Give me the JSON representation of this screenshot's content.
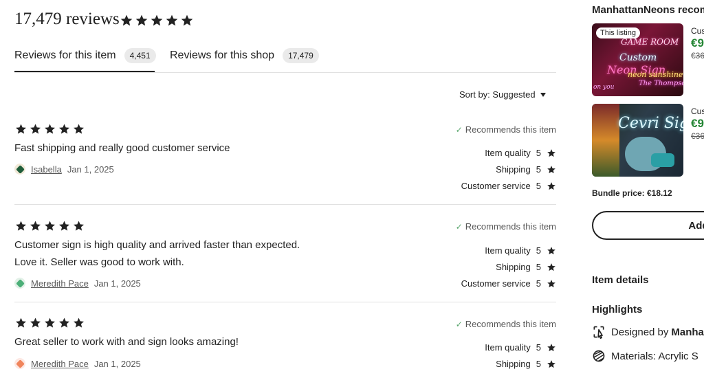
{
  "header": {
    "title": "17,479 reviews",
    "rating_stars": 5
  },
  "tabs": [
    {
      "label": "Reviews for this item",
      "count": "4,451",
      "active": true
    },
    {
      "label": "Reviews for this shop",
      "count": "17,479",
      "active": false
    }
  ],
  "sort": {
    "label": "Sort by: Suggested"
  },
  "reviews": [
    {
      "stars": 5,
      "text": "Fast shipping and really good customer service",
      "text2": "",
      "reviewer": "Isabella",
      "date": "Jan 1, 2025",
      "recommends": "Recommends this item",
      "ratings": [
        {
          "label": "Item quality",
          "value": "5"
        },
        {
          "label": "Shipping",
          "value": "5"
        },
        {
          "label": "Customer service",
          "value": "5"
        }
      ]
    },
    {
      "stars": 5,
      "text": "Customer sign is high quality and arrived faster than expected.",
      "text2": "Love it. Seller was good to work with.",
      "reviewer": "Meredith Pace",
      "date": "Jan 1, 2025",
      "recommends": "Recommends this item",
      "ratings": [
        {
          "label": "Item quality",
          "value": "5"
        },
        {
          "label": "Shipping",
          "value": "5"
        },
        {
          "label": "Customer service",
          "value": "5"
        }
      ]
    },
    {
      "stars": 5,
      "text": "Great seller to work with and sign looks amazing!",
      "text2": "",
      "reviewer": "Meredith Pace",
      "date": "Jan 1, 2025",
      "recommends": "Recommends this item",
      "ratings": [
        {
          "label": "Item quality",
          "value": "5"
        },
        {
          "label": "Shipping",
          "value": "5"
        }
      ]
    }
  ],
  "sidebar": {
    "shop_recommends": "ManhattanNeons recom",
    "listings": [
      {
        "badge": "This listing",
        "title": "Cus",
        "price": "€9",
        "original": "€36"
      },
      {
        "badge": "",
        "title": "Cus",
        "price": "€9",
        "original": "€36"
      }
    ],
    "bundle_price": "Bundle price: €18.12",
    "bundle_button": "Add",
    "item_details": "Item details",
    "highlights": "Highlights",
    "highlight_items": [
      {
        "icon": "designer-icon",
        "label": "Designed by ",
        "bold": "Manha"
      },
      {
        "icon": "materials-icon",
        "label": "Materials: Acrylic S",
        "bold": ""
      }
    ]
  },
  "colors": {
    "price_green": "#258635",
    "check_green": "#57a56b",
    "text": "#222222"
  }
}
